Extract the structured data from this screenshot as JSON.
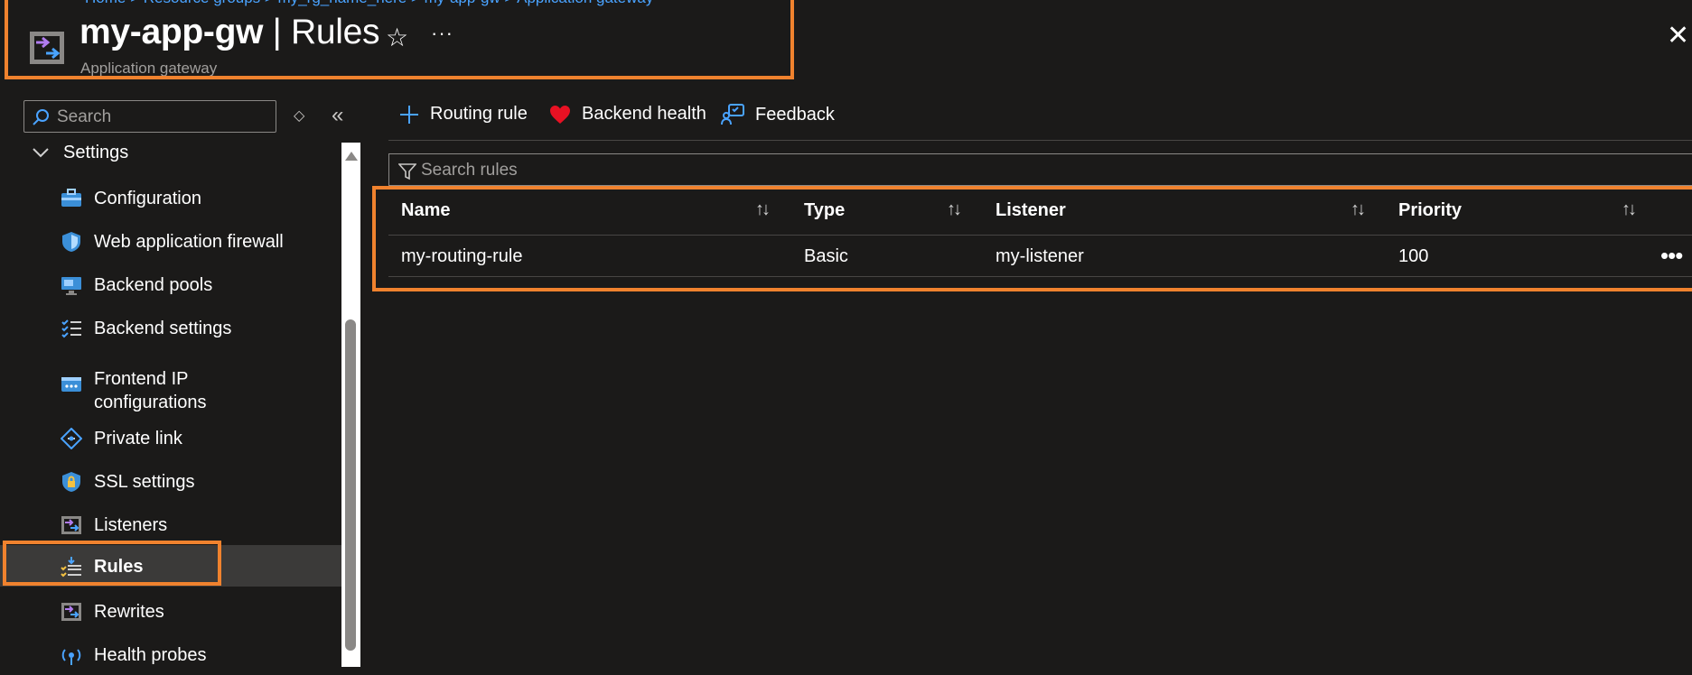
{
  "header": {
    "breadcrumb": "Home > Resource groups > my_rg_name_here > my-app-gw > Application gateway",
    "title_name": "my-app-gw",
    "title_sep": " | ",
    "title_page": "Rules",
    "subtitle": "Application gateway",
    "favorite_icon": "star-icon",
    "more_icon": "ellipsis-icon",
    "close_icon": "close-icon"
  },
  "sidebar": {
    "search_placeholder": "Search",
    "section": "Settings",
    "items": [
      {
        "label": "Configuration",
        "icon": "toolbox-icon"
      },
      {
        "label": "Web application firewall",
        "icon": "shield-icon"
      },
      {
        "label": "Backend pools",
        "icon": "monitor-icon"
      },
      {
        "label": "Backend settings",
        "icon": "checklist-icon"
      },
      {
        "label": "Frontend IP configurations",
        "icon": "ip-icon"
      },
      {
        "label": "Private link",
        "icon": "private-link-icon"
      },
      {
        "label": "SSL settings",
        "icon": "ssl-shield-icon"
      },
      {
        "label": "Listeners",
        "icon": "listener-icon"
      },
      {
        "label": "Rules",
        "icon": "rules-icon",
        "active": true
      },
      {
        "label": "Rewrites",
        "icon": "rewrite-icon"
      },
      {
        "label": "Health probes",
        "icon": "probe-icon"
      }
    ]
  },
  "toolbar": {
    "routing_rule": "Routing rule",
    "backend_health": "Backend health",
    "feedback": "Feedback"
  },
  "filter": {
    "placeholder": "Search rules"
  },
  "table": {
    "columns": [
      "Name",
      "Type",
      "Listener",
      "Priority"
    ],
    "rows": [
      {
        "name": "my-routing-rule",
        "type": "Basic",
        "listener": "my-listener",
        "priority": "100"
      }
    ]
  },
  "colors": {
    "background": "#1b1a19",
    "highlight": "#f0822e",
    "accent": "#4aa3ff"
  }
}
